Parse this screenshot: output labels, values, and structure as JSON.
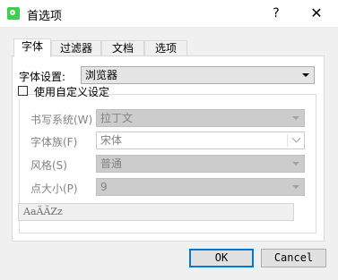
{
  "window": {
    "title": "首选项",
    "help_glyph": "?",
    "close_glyph": "✕"
  },
  "tabs": [
    {
      "label": "字体",
      "active": true
    },
    {
      "label": "过滤器",
      "active": false
    },
    {
      "label": "文档",
      "active": false
    },
    {
      "label": "选项",
      "active": false
    }
  ],
  "font_settings": {
    "label": "字体设置:",
    "value": "浏览器"
  },
  "custom": {
    "checkbox_label": "使用自定义设定",
    "checked": false,
    "writing_system_label": "书写系统(W)",
    "writing_system_value": "拉丁文",
    "font_family_label": "字体族(F)",
    "font_family_value": "宋体",
    "style_label": "风格(S)",
    "style_value": "普通",
    "point_size_label": "点大小(P)",
    "point_size_value": "9",
    "preview_text": "AaÄÃZz"
  },
  "buttons": {
    "ok": "OK",
    "cancel": "Cancel"
  },
  "colors": {
    "accent": "#0078d7",
    "app_icon": "#41cd52"
  }
}
